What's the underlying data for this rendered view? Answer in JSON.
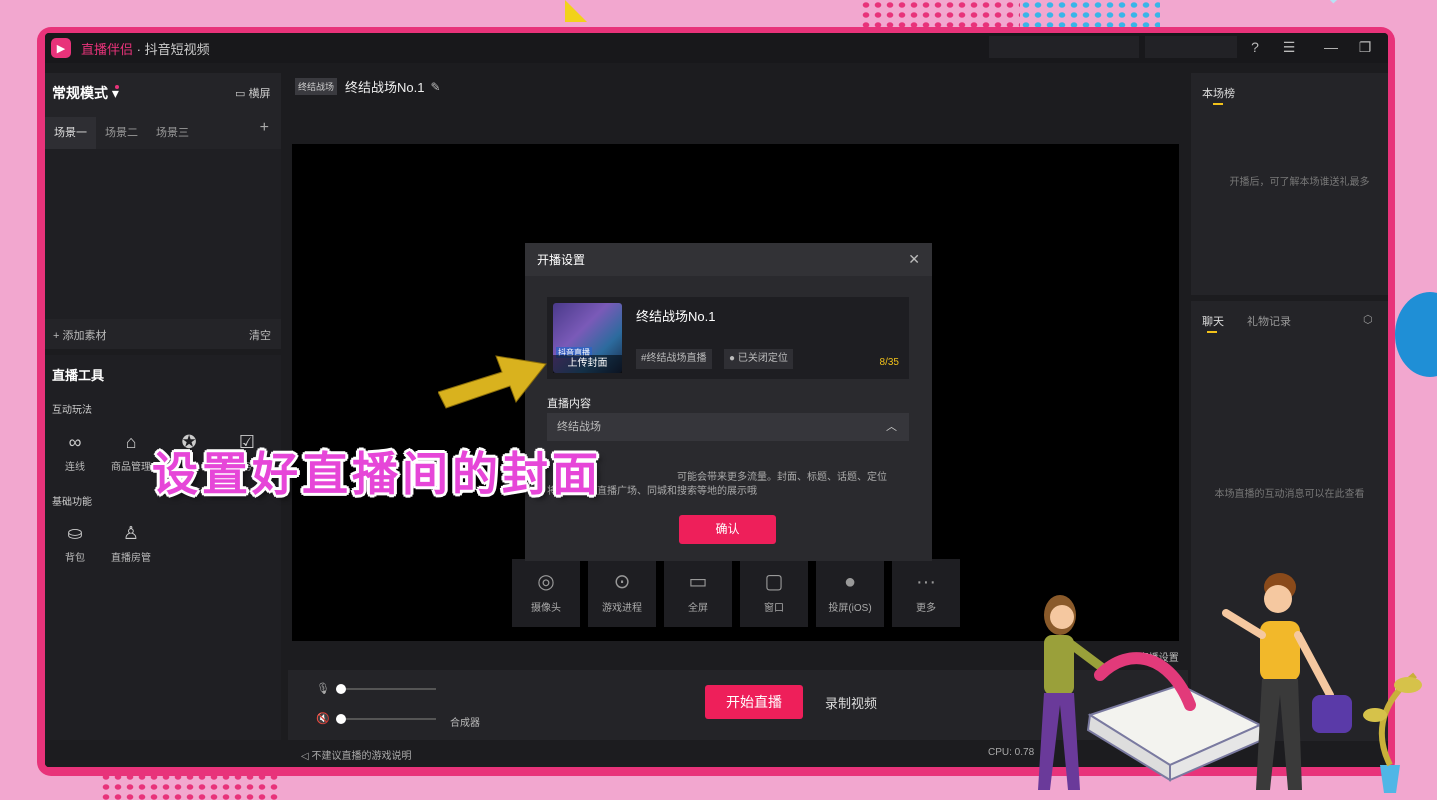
{
  "window": {
    "brand": "直播伴侣",
    "title_suffix": " · 抖音短视频",
    "icons": [
      "help-icon",
      "menu-icon",
      "minimize-icon",
      "restore-icon"
    ]
  },
  "left_panel": {
    "mode": "常规模式",
    "landscape_label": "横屏",
    "scenes": [
      "场景一",
      "场景二",
      "场景三"
    ],
    "add_material": "添加素材",
    "clear": "清空",
    "tools_title": "直播工具",
    "section_interactive": "互动玩法",
    "section_basic": "基础功能",
    "interactive_tools": [
      {
        "label": "连线",
        "icon": "link-icon"
      },
      {
        "label": "商品管理",
        "icon": "store-icon"
      },
      {
        "label": "",
        "icon": "star-icon"
      },
      {
        "label": "务",
        "icon": "task-icon"
      }
    ],
    "basic_tools": [
      {
        "label": "背包",
        "icon": "backpack-icon"
      },
      {
        "label": "直播房管",
        "icon": "room-admin-icon"
      }
    ]
  },
  "center": {
    "tag": "终结战场",
    "title": "终结战场No.1",
    "sources": [
      {
        "label": "摄像头",
        "icon": "camera-icon"
      },
      {
        "label": "游戏进程",
        "icon": "gamepad-icon"
      },
      {
        "label": "全屏",
        "icon": "monitor-icon"
      },
      {
        "label": "窗口",
        "icon": "window-icon"
      },
      {
        "label": "投屏(iOS)",
        "icon": "apple-icon"
      },
      {
        "label": "更多",
        "icon": "more-icon"
      }
    ],
    "live_settings": "直播设置",
    "mixer": "合成器",
    "start_live": "开始直播",
    "record_video": "录制视频"
  },
  "status": {
    "tip": "不建议直播的游戏说明",
    "cpu": "CPU: 0.78"
  },
  "right_panel": {
    "rank_tab": "本场榜",
    "rank_empty": "开播后，可了解本场谁送礼最多",
    "chat_tab": "聊天",
    "gift_tab": "礼物记录",
    "chat_empty": "本场直播的互动消息可以在此查看"
  },
  "modal": {
    "title": "开播设置",
    "cover_label": "上传封面",
    "cover_badge": "抖音直播",
    "stream_title": "终结战场No.1",
    "topic_tag": "#终结战场直播",
    "location_tag": "已关闭定位",
    "char_count": "8/35",
    "content_label": "直播内容",
    "content_value": "终结战场",
    "note_line1": "可能会带来更多流量。封面、标题、话题、定位",
    "note_line2": "将影响你在直播广场、同城和搜索等地的展示哦",
    "confirm": "确认"
  },
  "overlay": {
    "caption": "设置好直播间的封面"
  },
  "colors": {
    "accent": "#ee1f5a",
    "frame": "#e8337a",
    "caption": "#e646d8",
    "highlight": "#f2c21a"
  }
}
